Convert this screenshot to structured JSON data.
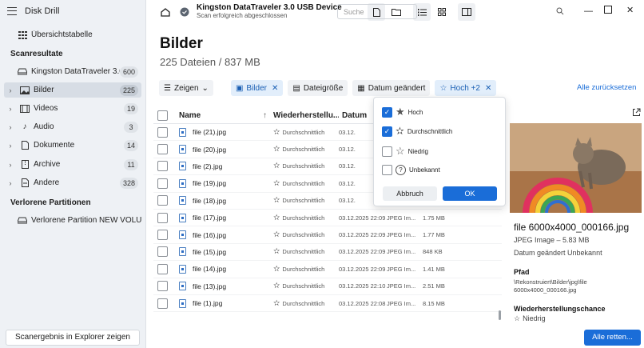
{
  "app": {
    "title": "Disk Drill"
  },
  "sidebar": {
    "overview": "Übersichtstabelle",
    "scan_results_heading": "Scanresultate",
    "device": {
      "label": "Kingston DataTraveler 3.0...",
      "count": "600"
    },
    "categories": [
      {
        "label": "Bilder",
        "count": "225",
        "icon": "image-icon",
        "selected": true
      },
      {
        "label": "Videos",
        "count": "19",
        "icon": "video-icon"
      },
      {
        "label": "Audio",
        "count": "3",
        "icon": "music-icon"
      },
      {
        "label": "Dokumente",
        "count": "14",
        "icon": "document-icon"
      },
      {
        "label": "Archive",
        "count": "11",
        "icon": "archive-icon"
      },
      {
        "label": "Andere",
        "count": "328",
        "icon": "other-file-icon"
      }
    ],
    "lost_heading": "Verlorene Partitionen",
    "lost_partition": "Verlorene Partition NEW VOLU...",
    "footer_button": "Scanergebnis in Explorer zeigen"
  },
  "topbar": {
    "device_title": "Kingston DataTraveler 3.0 USB Device",
    "device_subtitle": "Scan erfolgreich abgeschlossen",
    "search_placeholder": "Suche"
  },
  "main": {
    "title": "Bilder",
    "subtitle": "225 Dateien / 837 MB",
    "filters": {
      "show": "Zeigen",
      "images": "Bilder",
      "filesize": "Dateigröße",
      "date_changed": "Datum geändert",
      "rating": "Hoch +2",
      "reset": "Alle zurücksetzen"
    },
    "columns": {
      "name": "Name",
      "recovery": "Wiederherstellu...",
      "date": "Datum"
    },
    "rows": [
      {
        "name": "file (21).jpg",
        "recovery": "Durchschnittlich",
        "date": "03.12.",
        "type": "",
        "size": ""
      },
      {
        "name": "file (20).jpg",
        "recovery": "Durchschnittlich",
        "date": "03.12.",
        "type": "",
        "size": ""
      },
      {
        "name": "file (2).jpg",
        "recovery": "Durchschnittlich",
        "date": "03.12.",
        "type": "",
        "size": ""
      },
      {
        "name": "file (19).jpg",
        "recovery": "Durchschnittlich",
        "date": "03.12.",
        "type": "",
        "size": ""
      },
      {
        "name": "file (18).jpg",
        "recovery": "Durchschnittlich",
        "date": "03.12.",
        "type": "",
        "size": ""
      },
      {
        "name": "file (17).jpg",
        "recovery": "Durchschnittlich",
        "date": "03.12.2025 22:09",
        "type": "JPEG Im...",
        "size": "1.75 MB"
      },
      {
        "name": "file (16).jpg",
        "recovery": "Durchschnittlich",
        "date": "03.12.2025 22:09",
        "type": "JPEG Im...",
        "size": "1.77 MB"
      },
      {
        "name": "file (15).jpg",
        "recovery": "Durchschnittlich",
        "date": "03.12.2025 22:09",
        "type": "JPEG Im...",
        "size": "848 KB"
      },
      {
        "name": "file (14).jpg",
        "recovery": "Durchschnittlich",
        "date": "03.12.2025 22:09",
        "type": "JPEG Im...",
        "size": "1.41 MB"
      },
      {
        "name": "file (13).jpg",
        "recovery": "Durchschnittlich",
        "date": "03.12.2025 22:10",
        "type": "JPEG Im...",
        "size": "2.51 MB"
      },
      {
        "name": "file (1).jpg",
        "recovery": "Durchschnittlich",
        "date": "03.12.2025 22:08",
        "type": "JPEG Im...",
        "size": "8.15 MB"
      }
    ]
  },
  "popup": {
    "options": [
      {
        "label": "Hoch",
        "checked": true,
        "icon": "star-full-icon"
      },
      {
        "label": "Durchschnittlich",
        "checked": true,
        "icon": "star-half-icon"
      },
      {
        "label": "Niedrig",
        "checked": false,
        "icon": "star-empty-icon"
      },
      {
        "label": "Unbekannt",
        "checked": false,
        "icon": "question-icon"
      }
    ],
    "cancel": "Abbruch",
    "ok": "OK"
  },
  "preview": {
    "filename": "file 6000x4000_000166.jpg",
    "type_size": "JPEG Image – 5.83 MB",
    "date": "Datum geändert Unbekannt",
    "path_heading": "Pfad",
    "path_line1": "\\Rekonstruiert\\Bilder\\jpg\\file",
    "path_line2": "6000x4000_000166.jpg",
    "chance_heading": "Wiederherstellungschance",
    "chance_value": "Niedrig"
  },
  "footer": {
    "recover_all": "Alle retten..."
  },
  "colors": {
    "accent": "#1a6dd8",
    "sidebar_bg": "#eef1f5"
  }
}
